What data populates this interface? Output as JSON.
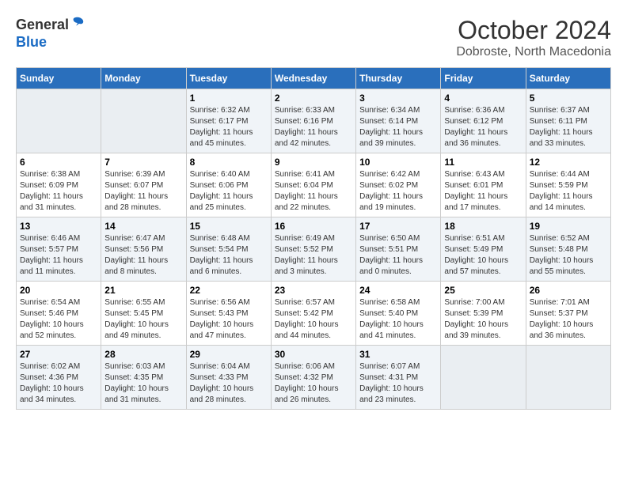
{
  "logo": {
    "general": "General",
    "blue": "Blue"
  },
  "header": {
    "month": "October 2024",
    "location": "Dobroste, North Macedonia"
  },
  "weekdays": [
    "Sunday",
    "Monday",
    "Tuesday",
    "Wednesday",
    "Thursday",
    "Friday",
    "Saturday"
  ],
  "weeks": [
    [
      {
        "day": "",
        "empty": true
      },
      {
        "day": "",
        "empty": true
      },
      {
        "day": "1",
        "sunrise": "Sunrise: 6:32 AM",
        "sunset": "Sunset: 6:17 PM",
        "daylight": "Daylight: 11 hours and 45 minutes."
      },
      {
        "day": "2",
        "sunrise": "Sunrise: 6:33 AM",
        "sunset": "Sunset: 6:16 PM",
        "daylight": "Daylight: 11 hours and 42 minutes."
      },
      {
        "day": "3",
        "sunrise": "Sunrise: 6:34 AM",
        "sunset": "Sunset: 6:14 PM",
        "daylight": "Daylight: 11 hours and 39 minutes."
      },
      {
        "day": "4",
        "sunrise": "Sunrise: 6:36 AM",
        "sunset": "Sunset: 6:12 PM",
        "daylight": "Daylight: 11 hours and 36 minutes."
      },
      {
        "day": "5",
        "sunrise": "Sunrise: 6:37 AM",
        "sunset": "Sunset: 6:11 PM",
        "daylight": "Daylight: 11 hours and 33 minutes."
      }
    ],
    [
      {
        "day": "6",
        "sunrise": "Sunrise: 6:38 AM",
        "sunset": "Sunset: 6:09 PM",
        "daylight": "Daylight: 11 hours and 31 minutes."
      },
      {
        "day": "7",
        "sunrise": "Sunrise: 6:39 AM",
        "sunset": "Sunset: 6:07 PM",
        "daylight": "Daylight: 11 hours and 28 minutes."
      },
      {
        "day": "8",
        "sunrise": "Sunrise: 6:40 AM",
        "sunset": "Sunset: 6:06 PM",
        "daylight": "Daylight: 11 hours and 25 minutes."
      },
      {
        "day": "9",
        "sunrise": "Sunrise: 6:41 AM",
        "sunset": "Sunset: 6:04 PM",
        "daylight": "Daylight: 11 hours and 22 minutes."
      },
      {
        "day": "10",
        "sunrise": "Sunrise: 6:42 AM",
        "sunset": "Sunset: 6:02 PM",
        "daylight": "Daylight: 11 hours and 19 minutes."
      },
      {
        "day": "11",
        "sunrise": "Sunrise: 6:43 AM",
        "sunset": "Sunset: 6:01 PM",
        "daylight": "Daylight: 11 hours and 17 minutes."
      },
      {
        "day": "12",
        "sunrise": "Sunrise: 6:44 AM",
        "sunset": "Sunset: 5:59 PM",
        "daylight": "Daylight: 11 hours and 14 minutes."
      }
    ],
    [
      {
        "day": "13",
        "sunrise": "Sunrise: 6:46 AM",
        "sunset": "Sunset: 5:57 PM",
        "daylight": "Daylight: 11 hours and 11 minutes."
      },
      {
        "day": "14",
        "sunrise": "Sunrise: 6:47 AM",
        "sunset": "Sunset: 5:56 PM",
        "daylight": "Daylight: 11 hours and 8 minutes."
      },
      {
        "day": "15",
        "sunrise": "Sunrise: 6:48 AM",
        "sunset": "Sunset: 5:54 PM",
        "daylight": "Daylight: 11 hours and 6 minutes."
      },
      {
        "day": "16",
        "sunrise": "Sunrise: 6:49 AM",
        "sunset": "Sunset: 5:52 PM",
        "daylight": "Daylight: 11 hours and 3 minutes."
      },
      {
        "day": "17",
        "sunrise": "Sunrise: 6:50 AM",
        "sunset": "Sunset: 5:51 PM",
        "daylight": "Daylight: 11 hours and 0 minutes."
      },
      {
        "day": "18",
        "sunrise": "Sunrise: 6:51 AM",
        "sunset": "Sunset: 5:49 PM",
        "daylight": "Daylight: 10 hours and 57 minutes."
      },
      {
        "day": "19",
        "sunrise": "Sunrise: 6:52 AM",
        "sunset": "Sunset: 5:48 PM",
        "daylight": "Daylight: 10 hours and 55 minutes."
      }
    ],
    [
      {
        "day": "20",
        "sunrise": "Sunrise: 6:54 AM",
        "sunset": "Sunset: 5:46 PM",
        "daylight": "Daylight: 10 hours and 52 minutes."
      },
      {
        "day": "21",
        "sunrise": "Sunrise: 6:55 AM",
        "sunset": "Sunset: 5:45 PM",
        "daylight": "Daylight: 10 hours and 49 minutes."
      },
      {
        "day": "22",
        "sunrise": "Sunrise: 6:56 AM",
        "sunset": "Sunset: 5:43 PM",
        "daylight": "Daylight: 10 hours and 47 minutes."
      },
      {
        "day": "23",
        "sunrise": "Sunrise: 6:57 AM",
        "sunset": "Sunset: 5:42 PM",
        "daylight": "Daylight: 10 hours and 44 minutes."
      },
      {
        "day": "24",
        "sunrise": "Sunrise: 6:58 AM",
        "sunset": "Sunset: 5:40 PM",
        "daylight": "Daylight: 10 hours and 41 minutes."
      },
      {
        "day": "25",
        "sunrise": "Sunrise: 7:00 AM",
        "sunset": "Sunset: 5:39 PM",
        "daylight": "Daylight: 10 hours and 39 minutes."
      },
      {
        "day": "26",
        "sunrise": "Sunrise: 7:01 AM",
        "sunset": "Sunset: 5:37 PM",
        "daylight": "Daylight: 10 hours and 36 minutes."
      }
    ],
    [
      {
        "day": "27",
        "sunrise": "Sunrise: 6:02 AM",
        "sunset": "Sunset: 4:36 PM",
        "daylight": "Daylight: 10 hours and 34 minutes."
      },
      {
        "day": "28",
        "sunrise": "Sunrise: 6:03 AM",
        "sunset": "Sunset: 4:35 PM",
        "daylight": "Daylight: 10 hours and 31 minutes."
      },
      {
        "day": "29",
        "sunrise": "Sunrise: 6:04 AM",
        "sunset": "Sunset: 4:33 PM",
        "daylight": "Daylight: 10 hours and 28 minutes."
      },
      {
        "day": "30",
        "sunrise": "Sunrise: 6:06 AM",
        "sunset": "Sunset: 4:32 PM",
        "daylight": "Daylight: 10 hours and 26 minutes."
      },
      {
        "day": "31",
        "sunrise": "Sunrise: 6:07 AM",
        "sunset": "Sunset: 4:31 PM",
        "daylight": "Daylight: 10 hours and 23 minutes."
      },
      {
        "day": "",
        "empty": true
      },
      {
        "day": "",
        "empty": true
      }
    ]
  ]
}
